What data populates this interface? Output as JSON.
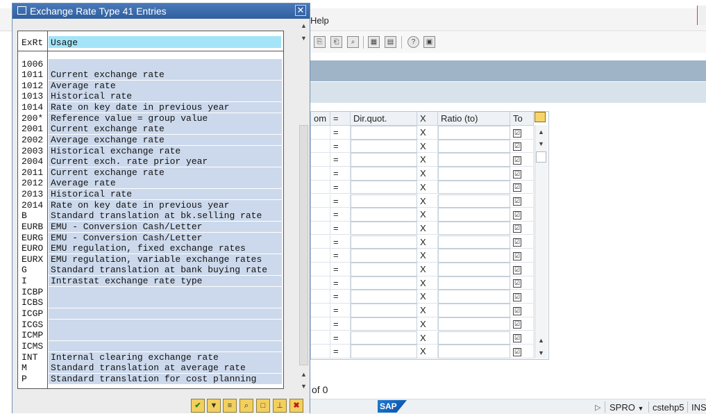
{
  "background": {
    "menu_help": "Help",
    "toolbar_icons": [
      "copy-icon",
      "copy-down-icon",
      "find-icon",
      "layout-icon",
      "export-icon",
      "help-icon",
      "settings-icon"
    ],
    "table": {
      "columns": [
        "om",
        "=",
        "Dir.quot.",
        "X",
        "Ratio (to)",
        "To"
      ],
      "rows": [
        {
          "eq": "=",
          "x": "X",
          "to": "☑"
        },
        {
          "eq": "=",
          "x": "X",
          "to": "☑"
        },
        {
          "eq": "=",
          "x": "X",
          "to": "☑"
        },
        {
          "eq": "=",
          "x": "X",
          "to": "☑"
        },
        {
          "eq": "=",
          "x": "X",
          "to": "☑"
        },
        {
          "eq": "=",
          "x": "X",
          "to": "☑"
        },
        {
          "eq": "=",
          "x": "X",
          "to": "☑"
        },
        {
          "eq": "=",
          "x": "X",
          "to": "☑"
        },
        {
          "eq": "=",
          "x": "X",
          "to": "☑"
        },
        {
          "eq": "=",
          "x": "X",
          "to": "☑"
        },
        {
          "eq": "=",
          "x": "X",
          "to": "☑"
        },
        {
          "eq": "=",
          "x": "X",
          "to": "☑"
        },
        {
          "eq": "=",
          "x": "X",
          "to": "☑"
        },
        {
          "eq": "=",
          "x": "X",
          "to": "☑"
        },
        {
          "eq": "=",
          "x": "X",
          "to": "☑"
        },
        {
          "eq": "=",
          "x": "X",
          "to": "☑"
        },
        {
          "eq": "=",
          "x": "X",
          "to": "☑"
        }
      ]
    },
    "page_info": "of 0",
    "status": {
      "logo": "SAP",
      "system": "SPRO",
      "client": "cstehp5",
      "mode": "INS"
    }
  },
  "dialog": {
    "title": "Exchange Rate Type 41 Entries",
    "header": {
      "code": "ExRt",
      "usage": "Usage"
    },
    "rows": [
      {
        "code": "1006",
        "usage": ""
      },
      {
        "code": "1011",
        "usage": "Current exchange rate"
      },
      {
        "code": "1012",
        "usage": "Average rate"
      },
      {
        "code": "1013",
        "usage": "Historical rate"
      },
      {
        "code": "1014",
        "usage": "Rate on key date in previous year"
      },
      {
        "code": "200*",
        "usage": "Reference value = group value"
      },
      {
        "code": "2001",
        "usage": "Current exchange rate"
      },
      {
        "code": "2002",
        "usage": "Average exchange rate"
      },
      {
        "code": "2003",
        "usage": "Historical exchange rate"
      },
      {
        "code": "2004",
        "usage": "Current exch. rate prior year"
      },
      {
        "code": "2011",
        "usage": "Current exchange rate"
      },
      {
        "code": "2012",
        "usage": "Average rate"
      },
      {
        "code": "2013",
        "usage": "Historical rate"
      },
      {
        "code": "2014",
        "usage": "Rate on key date in previous year"
      },
      {
        "code": "B",
        "usage": "Standard translation at bk.selling rate"
      },
      {
        "code": "EURB",
        "usage": "EMU - Conversion Cash/Letter"
      },
      {
        "code": "EURG",
        "usage": "EMU - Conversion Cash/Letter"
      },
      {
        "code": "EURO",
        "usage": "EMU regulation, fixed exchange rates"
      },
      {
        "code": "EURX",
        "usage": "EMU regulation, variable exchange rates"
      },
      {
        "code": "G",
        "usage": "Standard translation at bank buying rate"
      },
      {
        "code": "I",
        "usage": "Intrastat exchange rate type"
      },
      {
        "code": "ICBP",
        "usage": ""
      },
      {
        "code": "ICBS",
        "usage": ""
      },
      {
        "code": "ICGP",
        "usage": ""
      },
      {
        "code": "ICGS",
        "usage": ""
      },
      {
        "code": "ICMP",
        "usage": ""
      },
      {
        "code": "ICMS",
        "usage": ""
      },
      {
        "code": "INT",
        "usage": "Internal clearing exchange rate"
      },
      {
        "code": "M",
        "usage": "Standard translation at average rate"
      },
      {
        "code": "P",
        "usage": "Standard translation for cost planning"
      }
    ],
    "buttons": [
      "ok-icon",
      "filter-icon",
      "sort-icon",
      "find-icon",
      "new-icon",
      "pin-icon",
      "cancel-icon"
    ]
  }
}
